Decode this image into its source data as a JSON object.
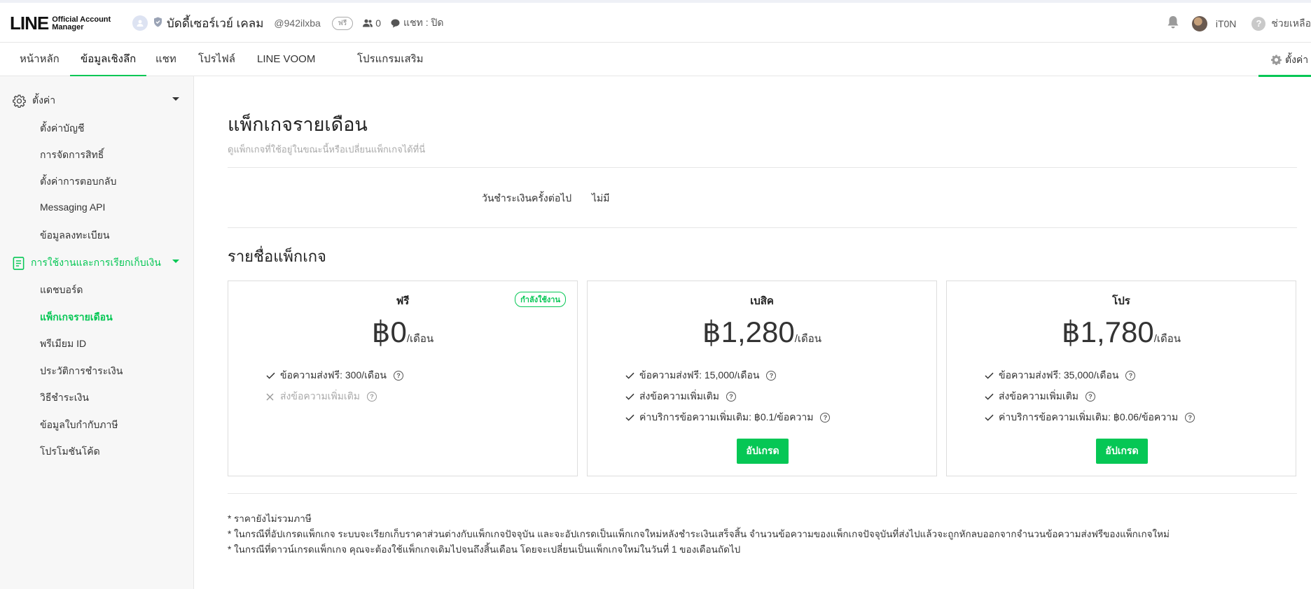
{
  "header": {
    "logo_main": "LINE",
    "logo_sub_1": "Official Account",
    "logo_sub_2": "Manager",
    "account_name": "บัดดี้เซอร์เวย์ เคลม",
    "account_id": "@942ilxba",
    "plan_badge": "ฟรี",
    "friends_count": "0",
    "chat_status": "แชท : ปิด",
    "user_name": "iT0N",
    "help_label": "ช่วยเหลือ"
  },
  "nav": {
    "tabs": [
      "หน้าหลัก",
      "ข้อมูลเชิงลึก",
      "แชท",
      "โปรไฟล์",
      "LINE VOOM",
      "โปรแกรมเสริม"
    ],
    "active_tab": "ข้อมูลเชิงลึก",
    "settings_label": "ตั้งค่า"
  },
  "sidebar": {
    "section1_label": "ตั้งค่า",
    "section1_items": [
      "ตั้งค่าบัญชี",
      "การจัดการสิทธิ์",
      "ตั้งค่าการตอบกลับ",
      "Messaging API",
      "ข้อมูลลงทะเบียน"
    ],
    "section2_label": "การใช้งานและการเรียกเก็บเงิน",
    "section2_items": [
      "แดชบอร์ด",
      "แพ็กเกจรายเดือน",
      "พรีเมียม ID",
      "ประวัติการชำระเงิน",
      "วิธีชำระเงิน",
      "ข้อมูลใบกำกับภาษี",
      "โปรโมชันโค้ด"
    ],
    "active_item": "แพ็กเกจรายเดือน"
  },
  "main": {
    "title": "แพ็กเกจรายเดือน",
    "subtitle": "ดูแพ็กเกจที่ใช้อยู่ในขณะนี้หรือเปลี่ยนแพ็กเกจได้ที่นี่",
    "next_billing_label": "วันชำระเงินครั้งต่อไป",
    "next_billing_value": "ไม่มี",
    "packages_title": "รายชื่อแพ็กเกจ",
    "per_month": "/เดือน",
    "upgrade_label": "อัปเกรด",
    "current_badge": "กำลังใช้งาน",
    "plans": [
      {
        "name": "ฟรี",
        "price": "฿0",
        "features": [
          "ข้อความส่งฟรี: 300/เดือน",
          "ส่งข้อความเพิ่มเติม"
        ],
        "feature_enabled": [
          true,
          false
        ]
      },
      {
        "name": "เบสิค",
        "price": "฿1,280",
        "features": [
          "ข้อความส่งฟรี: 15,000/เดือน",
          "ส่งข้อความเพิ่มเติม",
          "ค่าบริการข้อความเพิ่มเติม: ฿0.1/ข้อความ"
        ],
        "feature_enabled": [
          true,
          true,
          true
        ]
      },
      {
        "name": "โปร",
        "price": "฿1,780",
        "features": [
          "ข้อความส่งฟรี: 35,000/เดือน",
          "ส่งข้อความเพิ่มเติม",
          "ค่าบริการข้อความเพิ่มเติม: ฿0.06/ข้อความ"
        ],
        "feature_enabled": [
          true,
          true,
          true
        ]
      }
    ],
    "notes": [
      "* ราคายังไม่รวมภาษี",
      "* ในกรณีที่อัปเกรดแพ็กเกจ ระบบจะเรียกเก็บราคาส่วนต่างกับแพ็กเกจปัจจุบัน และจะอัปเกรดเป็นแพ็กเกจใหม่หลังชำระเงินเสร็จสิ้น จำนวนข้อความของแพ็กเกจปัจจุบันที่ส่งไปแล้วจะถูกหักลบออกจากจำนวนข้อความส่งฟรีของแพ็กเกจใหม่",
      "* ในกรณีที่ดาวน์เกรดแพ็กเกจ คุณจะต้องใช้แพ็กเกจเดิมไปจนถึงสิ้นเดือน โดยจะเปลี่ยนเป็นแพ็กเกจใหม่ในวันที่ 1 ของเดือนถัดไป"
    ]
  },
  "colors": {
    "accent": "#06c755",
    "border": "#dddddd",
    "sidebar_bg": "#f7f7f7"
  }
}
